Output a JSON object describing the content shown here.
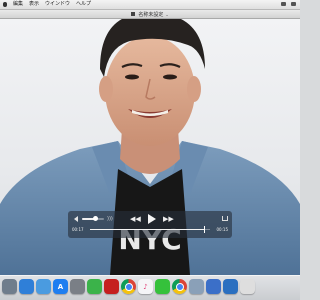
{
  "menubar": {
    "items": [
      "編集",
      "表示",
      "ウインドウ",
      "ヘルプ"
    ]
  },
  "window": {
    "title": "名称未設定",
    "chevron": "⌄"
  },
  "player": {
    "time_elapsed": "00:17",
    "time_total": "00:15",
    "progress": 0.95,
    "volume": 0.6,
    "rewind_glyph": "◀◀",
    "forward_glyph": "▶▶",
    "volume_high_glyph": ")))"
  },
  "video_frame": {
    "shirt_text": "NYC"
  },
  "dock": {
    "icons": [
      {
        "name": "launchpad-icon",
        "color": "#6f7d8c",
        "glyph": ""
      },
      {
        "name": "safari-icon",
        "color": "#2f7fd8",
        "glyph": ""
      },
      {
        "name": "mail-icon",
        "color": "#4a9be0",
        "glyph": ""
      },
      {
        "name": "app-store-icon",
        "color": "#1e7ef0",
        "glyph": "A"
      },
      {
        "name": "system-preferences-icon",
        "color": "#7a7f86",
        "glyph": ""
      },
      {
        "name": "evernote-icon",
        "color": "#3bb34a",
        "glyph": ""
      },
      {
        "name": "acrobat-icon",
        "color": "#c51f1f",
        "glyph": ""
      },
      {
        "name": "chrome-icon",
        "color": "#e8e8e8",
        "glyph": ""
      },
      {
        "name": "itunes-icon",
        "color": "#f5f5f7",
        "glyph": "♪"
      },
      {
        "name": "line-icon",
        "color": "#35c13b",
        "glyph": ""
      },
      {
        "name": "chrome-icon-2",
        "color": "#e8e8e8",
        "glyph": ""
      },
      {
        "name": "image-viewer-icon",
        "color": "#8aa0b8",
        "glyph": ""
      },
      {
        "name": "keynote-icon",
        "color": "#3b6fc8",
        "glyph": ""
      },
      {
        "name": "globe-icon",
        "color": "#2a6fc0",
        "glyph": ""
      },
      {
        "name": "quicktime-icon",
        "color": "#dedede",
        "glyph": ""
      }
    ]
  }
}
